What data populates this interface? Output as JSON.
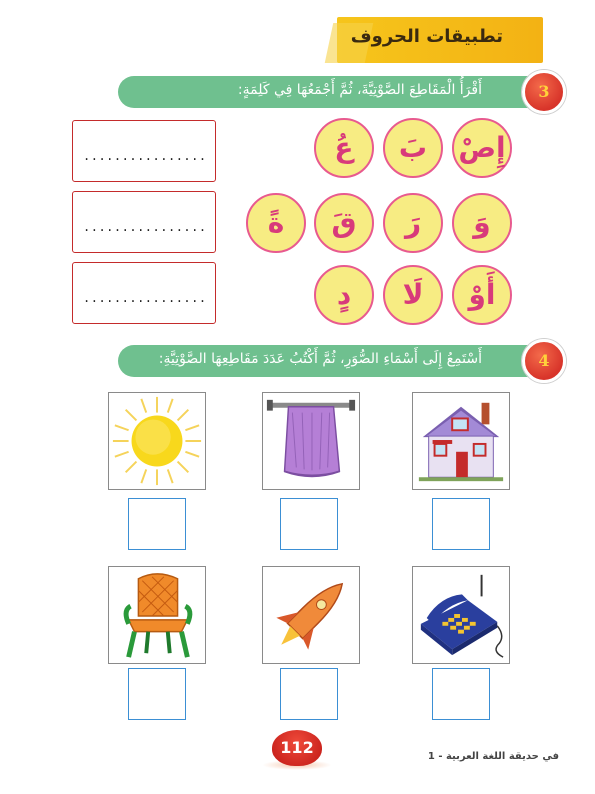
{
  "header": {
    "title": "تطبيقات الحروف"
  },
  "section3": {
    "number": "3",
    "instruction": "أَقْرَأُ الْمَقَاطِعَ الصَّوْتِيَّةَ، ثُمَّ أَجْمَعُهَا فِي كَلِمَةٍ:",
    "syllable_rows": [
      [
        "إِصْ",
        "بَ",
        "عُ"
      ],
      [
        "وَ",
        "رَ",
        "قَ",
        "ةً"
      ],
      [
        "أَوْ",
        "لَا",
        "دٍ"
      ]
    ],
    "answer_placeholder": "........................."
  },
  "section4": {
    "number": "4",
    "instruction": "أَسْتَمِعُ إِلَى أَسْمَاءِ الصُّوَرِ، ثُمَّ أَكْتُبُ عَدَدَ مَقَاطِعِهَا الصَّوْتِيَّةِ:",
    "pictures": [
      "house-icon",
      "towel-icon",
      "sun-icon",
      "telephone-icon",
      "rocket-icon",
      "chair-icon"
    ]
  },
  "footer": {
    "page_number": "112",
    "book_title": "في حديقة اللغة العربية - 1"
  },
  "colors": {
    "banner": "#f6c51b",
    "section_bar": "#6fc08f",
    "number_circle": "#d8342a",
    "syllable_fill": "#f7ec83",
    "syllable_border": "#e85a8f",
    "syllable_text": "#d83a7b",
    "answer_border": "#c42b2b",
    "count_box_border": "#3b8fd4"
  }
}
